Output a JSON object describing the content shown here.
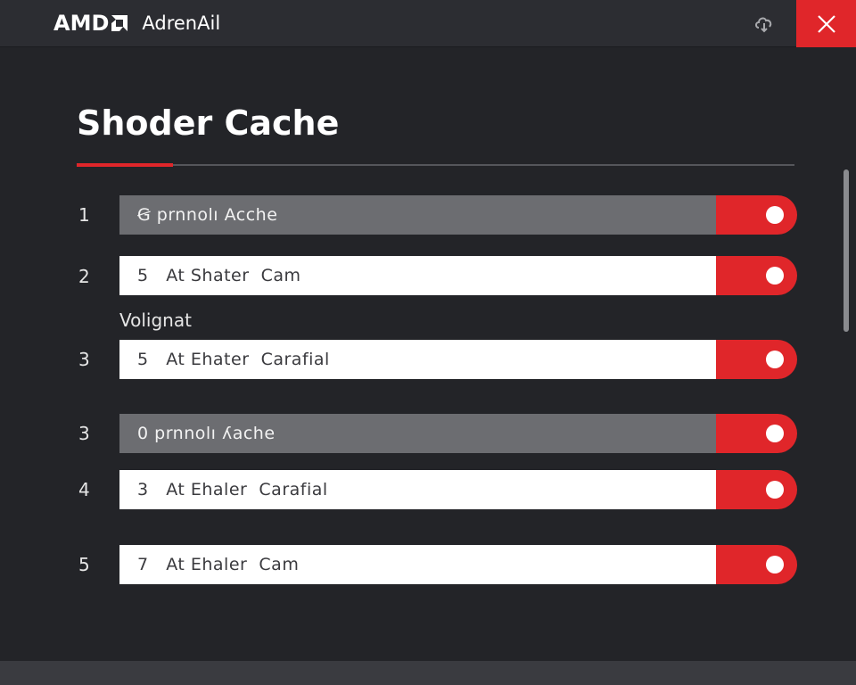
{
  "window": {
    "brand": "AMD",
    "app_name": "AdrenAil",
    "cloud_icon": "cloud-icon",
    "close_icon": "close-icon",
    "accent_color": "#e0262a"
  },
  "page": {
    "title": "Shoder Cache"
  },
  "rows": [
    {
      "number": "1",
      "label": "Ꞡ prnnolı Acche",
      "state": "on"
    },
    {
      "number": "2",
      "label": "5   At Shater  Cam",
      "state": "on"
    },
    {
      "number": "3",
      "label": "5   At Ehater  Carafial",
      "state": "on"
    },
    {
      "number": "3",
      "label": "0 prnnolı ʎache",
      "state": "on"
    },
    {
      "number": "4",
      "label": "3   At Ehaler  Carafial",
      "state": "on"
    },
    {
      "number": "5",
      "label": "7   At Ehaler  Cam",
      "state": "on"
    }
  ],
  "section": {
    "label": "Volignat"
  }
}
